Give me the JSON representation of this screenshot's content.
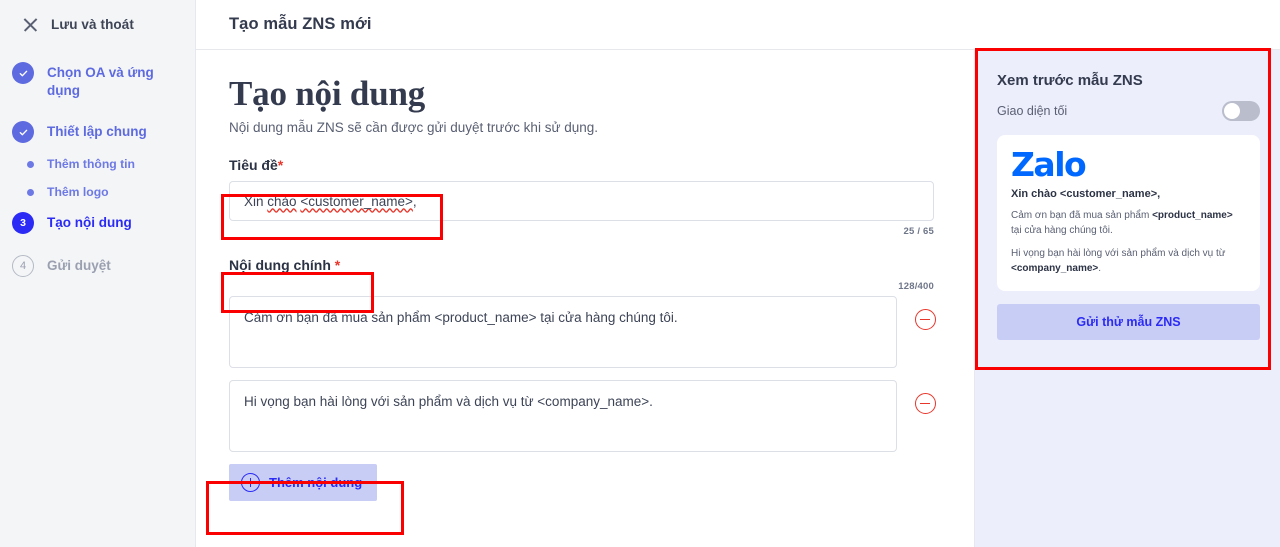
{
  "sidebar": {
    "exit": {
      "label": "Lưu và thoát",
      "icon": "close-icon"
    },
    "steps": [
      {
        "label": "Chọn OA và ứng dụng",
        "state": "done",
        "marker": "check-icon"
      },
      {
        "label": "Thiết lập chung",
        "state": "done",
        "marker": "check-icon"
      }
    ],
    "substeps": [
      {
        "label": "Thêm thông tin"
      },
      {
        "label": "Thêm logo"
      }
    ],
    "active_step": {
      "number": "3",
      "label": "Tạo nội dung",
      "state": "active"
    },
    "next_step": {
      "number": "4",
      "label": "Gửi duyệt",
      "state": "todo"
    }
  },
  "header": {
    "title": "Tạo mẫu ZNS mới"
  },
  "form": {
    "page_title": "Tạo nội dung",
    "page_subtitle": "Nội dung mẫu ZNS sẽ cần được gửi duyệt trước khi sử dụng.",
    "title_field": {
      "label": "Tiêu đề",
      "required_mark": "*",
      "value_prefix": "Xin ",
      "value_word1": "chào",
      "value_word2": "<customer_name>",
      "value_suffix": ",",
      "counter": "25 / 65"
    },
    "body_field": {
      "label": "Nội dung chính",
      "required_mark": "*",
      "counter": "128/400",
      "paragraphs": [
        {
          "value": "Cảm ơn bạn đã mua sản phẩm <product_name> tại cửa hàng chúng tôi.",
          "remove_icon": "minus-circle-icon"
        },
        {
          "value": "Hi vọng bạn hài lòng với sản phẩm và dịch vụ từ <company_name>.",
          "remove_icon": "minus-circle-icon"
        }
      ]
    },
    "add_content_button": {
      "label": "Thêm nội dung",
      "icon": "plus-circle-icon"
    }
  },
  "preview": {
    "title": "Xem trước mẫu ZNS",
    "dark_mode": {
      "label": "Giao diện tối",
      "enabled": false
    },
    "card": {
      "logo": "Zalo",
      "greeting": "Xin chào <customer_name>,",
      "line1_a": "Cảm ơn bạn đã mua sản phẩm ",
      "line1_b": "<product_name>",
      "line1_c": " tại cửa hàng chúng tôi.",
      "line2_a": "Hi vọng bạn hài lòng với sản phẩm và dịch vụ từ ",
      "line2_b": "<company_name>",
      "line2_c": "."
    },
    "send_test_button": "Gửi thử mẫu ZNS"
  },
  "colors": {
    "accent_blue": "#2b2bf5",
    "step_purple": "#5d6ae0",
    "zalo_blue": "#0068ff",
    "danger_red": "#e8362b",
    "highlight_red": "#fb0000",
    "button_lavender": "#c8cdf5",
    "preview_bg": "#eceefb"
  }
}
